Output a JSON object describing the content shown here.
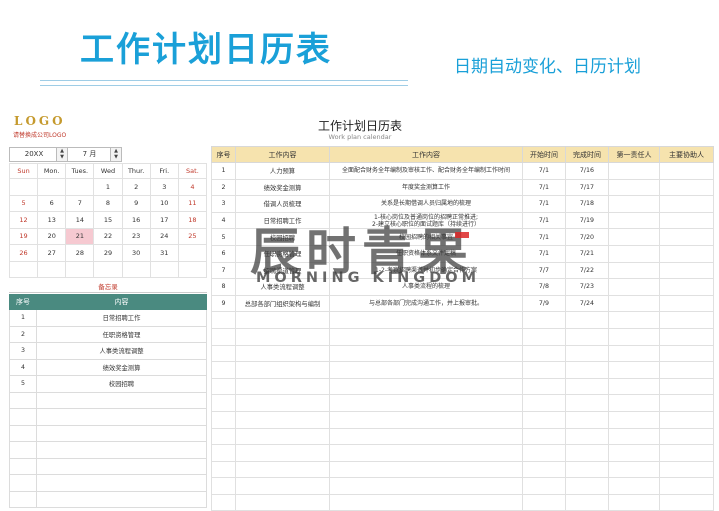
{
  "header": {
    "title": "工作计划日历表",
    "subtitle": "日期自动变化、日历计划"
  },
  "logo": {
    "text": "LOGO",
    "note": "请替换成公司LOGO"
  },
  "calendar_title": "工作计划日历表",
  "calendar_subtitle": "Work plan calendar",
  "selector": {
    "year": "20XX",
    "month": "7 月"
  },
  "mini_calendar": {
    "weekdays": [
      "Sun",
      "Mon.",
      "Tues.",
      "Wed",
      "Thur.",
      "Fri.",
      "Sat."
    ],
    "weeks": [
      [
        "",
        "",
        "",
        "1",
        "2",
        "3",
        "4"
      ],
      [
        "5",
        "6",
        "7",
        "8",
        "9",
        "10",
        "11"
      ],
      [
        "12",
        "13",
        "14",
        "15",
        "16",
        "17",
        "18"
      ],
      [
        "19",
        "20",
        "21",
        "22",
        "23",
        "24",
        "25"
      ],
      [
        "26",
        "27",
        "28",
        "29",
        "30",
        "31",
        ""
      ]
    ],
    "highlight_day": "21"
  },
  "memo": {
    "label": "备忘录",
    "headers": [
      "序号",
      "内容"
    ],
    "rows": [
      [
        "1",
        "日常招聘工作"
      ],
      [
        "2",
        "任职资格管理"
      ],
      [
        "3",
        "人事类流程调整"
      ],
      [
        "4",
        "绩效奖金测算"
      ],
      [
        "5",
        "校园招聘"
      ]
    ]
  },
  "plan": {
    "headers": [
      "序号",
      "工作内容",
      "工作内容",
      "开始时间",
      "完成时间",
      "第一责任人",
      "主要协助人"
    ],
    "rows": [
      {
        "no": "1",
        "item": "人力预算",
        "detail": [
          "全面配合财务全年编制及审核工作、配合财务全年编制工作时间"
        ],
        "start": "7/1",
        "end": "7/16"
      },
      {
        "no": "2",
        "item": "绩效奖金测算",
        "detail": [
          "年度奖金测算工作"
        ],
        "start": "7/1",
        "end": "7/17"
      },
      {
        "no": "3",
        "item": "借调人员梳理",
        "detail": [
          "关系是长期借调人员归属地的梳理"
        ],
        "start": "7/1",
        "end": "7/18"
      },
      {
        "no": "4",
        "item": "日常招聘工作",
        "detail": [
          "1-核心岗位及普通岗位的招聘正常推进;",
          "2-建立核心职位的面试题库（持续进行）"
        ],
        "start": "7/1",
        "end": "7/19"
      },
      {
        "no": "5",
        "item": "校园招聘",
        "detail": [
          "校园招聘的相关事宜"
        ],
        "start": "7/1",
        "end": "7/20"
      },
      {
        "no": "6",
        "item": "任职资格管理",
        "detail": [
          "任职资格体系文件定稿"
        ],
        "start": "7/1",
        "end": "7/21"
      },
      {
        "no": "7",
        "item": "招聘渠道管理",
        "detail": [
          "1-2-考察招聘渠道并初步确定合作方案"
        ],
        "start": "7/7",
        "end": "7/22"
      },
      {
        "no": "8",
        "item": "人事类流程调整",
        "detail": [
          "人事类流程的梳理"
        ],
        "start": "7/8",
        "end": "7/23"
      },
      {
        "no": "9",
        "item": "总部各部门组织架构与编制",
        "detail": [
          "与总部各部门完成沟通工作，并上报审批。"
        ],
        "start": "7/9",
        "end": "7/24"
      }
    ]
  },
  "watermark": {
    "cn": "辰时青果",
    "en": "MORNING KINGDOM"
  },
  "colors": {
    "title": "#1aa0d8",
    "memo_header": "#4a8a80",
    "plan_header": "#f6e3ae",
    "weekend": "#c0392b",
    "highlight": "#f6c9d1"
  }
}
